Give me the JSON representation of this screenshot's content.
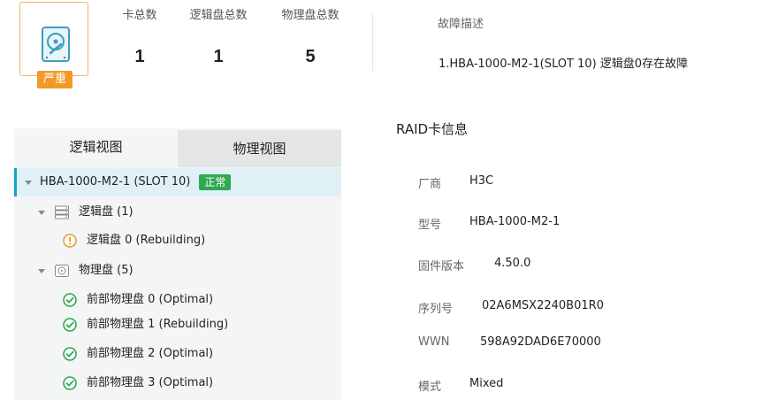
{
  "summary": {
    "severity_label": "严重",
    "stats": [
      {
        "label": "卡总数",
        "value": "1"
      },
      {
        "label": "逻辑盘总数",
        "value": "1"
      },
      {
        "label": "物理盘总数",
        "value": "5"
      }
    ],
    "fault_title": "故障描述",
    "fault_text": "1.HBA-1000-M2-1(SLOT 10) 逻辑盘0存在故障"
  },
  "tabs": {
    "logical": "逻辑视图",
    "physical": "物理视图"
  },
  "tree": {
    "controller": {
      "label": "HBA-1000-M2-1 (SLOT 10)",
      "status": "正常"
    },
    "logical_group": {
      "label": "逻辑盘 (1)"
    },
    "logical_disks": [
      {
        "label": "逻辑盘 0 (Rebuilding)",
        "state": "warning"
      }
    ],
    "physical_group": {
      "label": "物理盘 (5)"
    },
    "physical_disks": [
      {
        "label": "前部物理盘 0 (Optimal)",
        "state": "ok"
      },
      {
        "label": "前部物理盘 1 (Rebuilding)",
        "state": "ok"
      },
      {
        "label": "前部物理盘 2 (Optimal)",
        "state": "ok"
      },
      {
        "label": "前部物理盘 3 (Optimal)",
        "state": "ok"
      }
    ]
  },
  "raid_info": {
    "title": "RAID卡信息",
    "fields": [
      {
        "key": "厂商",
        "value": "H3C"
      },
      {
        "key": "型号",
        "value": "HBA-1000-M2-1"
      },
      {
        "key": "固件版本",
        "value": "4.50.0"
      },
      {
        "key": "序列号",
        "value": "02A6MSX2240B01R0"
      },
      {
        "key": "WWN",
        "value": "598A92DAD6E70000"
      },
      {
        "key": "模式",
        "value": "Mixed"
      }
    ]
  },
  "colors": {
    "severity": "#f29a26",
    "ok": "#2fa84f",
    "warning": "#f29a26",
    "selected_bg": "#dff1f7",
    "accent": "#14a1c6"
  }
}
